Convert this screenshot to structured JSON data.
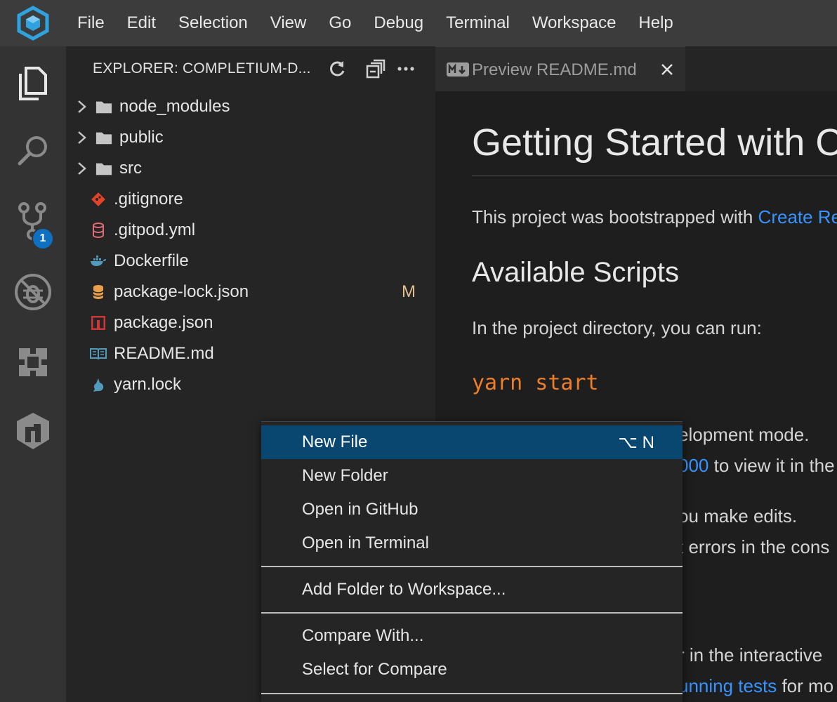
{
  "menubar": {
    "items": [
      "File",
      "Edit",
      "Selection",
      "View",
      "Go",
      "Debug",
      "Terminal",
      "Workspace",
      "Help"
    ]
  },
  "activitybar": {
    "items": [
      "explorer-icon",
      "search-icon",
      "source-control-icon",
      "debug-icon",
      "extensions-icon",
      "gitpod-icon"
    ],
    "scm_badge": "1"
  },
  "sidebar": {
    "title": "EXPLORER: COMPLETIUM-D...",
    "actions": [
      "refresh-icon",
      "collapse-all-icon",
      "more-actions-icon"
    ],
    "tree": [
      {
        "name": "node_modules",
        "kind": "folder"
      },
      {
        "name": "public",
        "kind": "folder"
      },
      {
        "name": "src",
        "kind": "folder"
      },
      {
        "name": ".gitignore",
        "kind": "file",
        "icon": "git-icon",
        "color": "#e24329"
      },
      {
        "name": ".gitpod.yml",
        "kind": "file",
        "icon": "yaml-icon",
        "color": "#e06c75"
      },
      {
        "name": "Dockerfile",
        "kind": "file",
        "icon": "docker-icon",
        "color": "#519aba"
      },
      {
        "name": "package-lock.json",
        "kind": "file",
        "icon": "db-icon",
        "color": "#e8a04a",
        "status": "M"
      },
      {
        "name": "package.json",
        "kind": "file",
        "icon": "npm-icon",
        "color": "#cb3837"
      },
      {
        "name": "README.md",
        "kind": "file",
        "icon": "book-icon",
        "color": "#519aba"
      },
      {
        "name": "yarn.lock",
        "kind": "file",
        "icon": "yarn-icon",
        "color": "#519aba"
      }
    ]
  },
  "editor": {
    "tab": {
      "label": "Preview README.md"
    },
    "content": {
      "h1": "Getting Started with Create React App",
      "p1_text": "This project was bootstrapped with ",
      "p1_link": "Create React App",
      "h2": "Available Scripts",
      "p2": "In the project directory, you can run:",
      "code": "yarn start",
      "behind_lines": [
        {
          "text": "elopment mode."
        },
        {
          "link": "000",
          "text": " to view it in the"
        },
        {
          "text": "ou make edits."
        },
        {
          "text": "t errors in the cons"
        },
        {
          "text": "r in the interactive"
        },
        {
          "link": "unning tests",
          "text": " for mo"
        }
      ]
    }
  },
  "context_menu": {
    "groups": [
      [
        {
          "label": "New File",
          "shortcut": "⌥ N",
          "selected": true
        },
        {
          "label": "New Folder"
        },
        {
          "label": "Open in GitHub"
        },
        {
          "label": "Open in Terminal"
        }
      ],
      [
        {
          "label": "Add Folder to Workspace..."
        }
      ],
      [
        {
          "label": "Compare With..."
        },
        {
          "label": "Select for Compare"
        }
      ]
    ]
  },
  "colors": {
    "accent": "#0e70c0",
    "selection": "#094771",
    "link": "#3794ff",
    "modified": "#e2c08d",
    "code": "#ee7d28"
  }
}
